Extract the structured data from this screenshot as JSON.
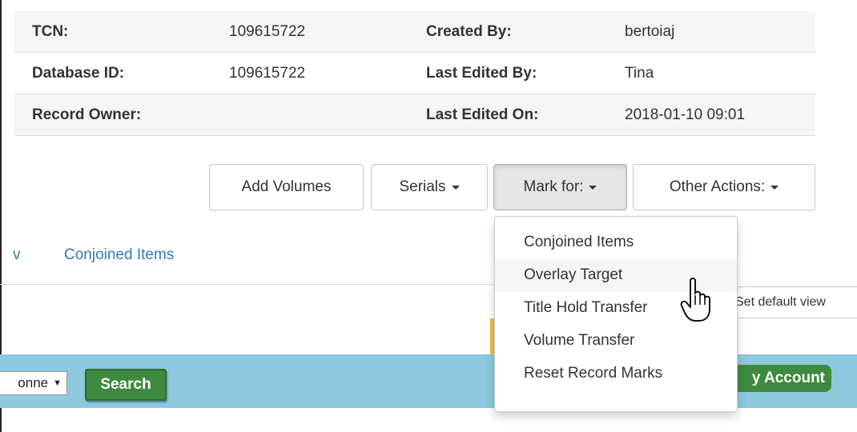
{
  "record_summary": {
    "rows": [
      {
        "label1": "TCN:",
        "value1": "109615722",
        "label2": "Created By:",
        "value2": "bertoiaj"
      },
      {
        "label1": "Database ID:",
        "value1": "109615722",
        "label2": "Last Edited By:",
        "value2": "Tina"
      },
      {
        "label1": "Record Owner:",
        "value1": "",
        "label2": "Last Edited On:",
        "value2": "2018-01-10 09:01"
      }
    ]
  },
  "actions": {
    "add_volumes": "Add Volumes",
    "serials": "Serials",
    "mark_for": "Mark for:",
    "other_actions": "Other Actions:"
  },
  "mark_for_menu": {
    "items": [
      "Conjoined Items",
      "Overlay Target",
      "Title Hold Transfer",
      "Volume Transfer",
      "Reset Record Marks"
    ],
    "hovered_item": "Overlay Target"
  },
  "tabs": {
    "partial_tab": "v",
    "conjoined_items": "Conjoined Items"
  },
  "set_default_view": "Set default view",
  "search_bar": {
    "select_value": "onne",
    "search_button": "Search",
    "account_button": "y Account"
  },
  "colors": {
    "link": "#337ab7",
    "search_bar_bg": "#8ec9e0",
    "green_button": "#3e8a3e"
  }
}
